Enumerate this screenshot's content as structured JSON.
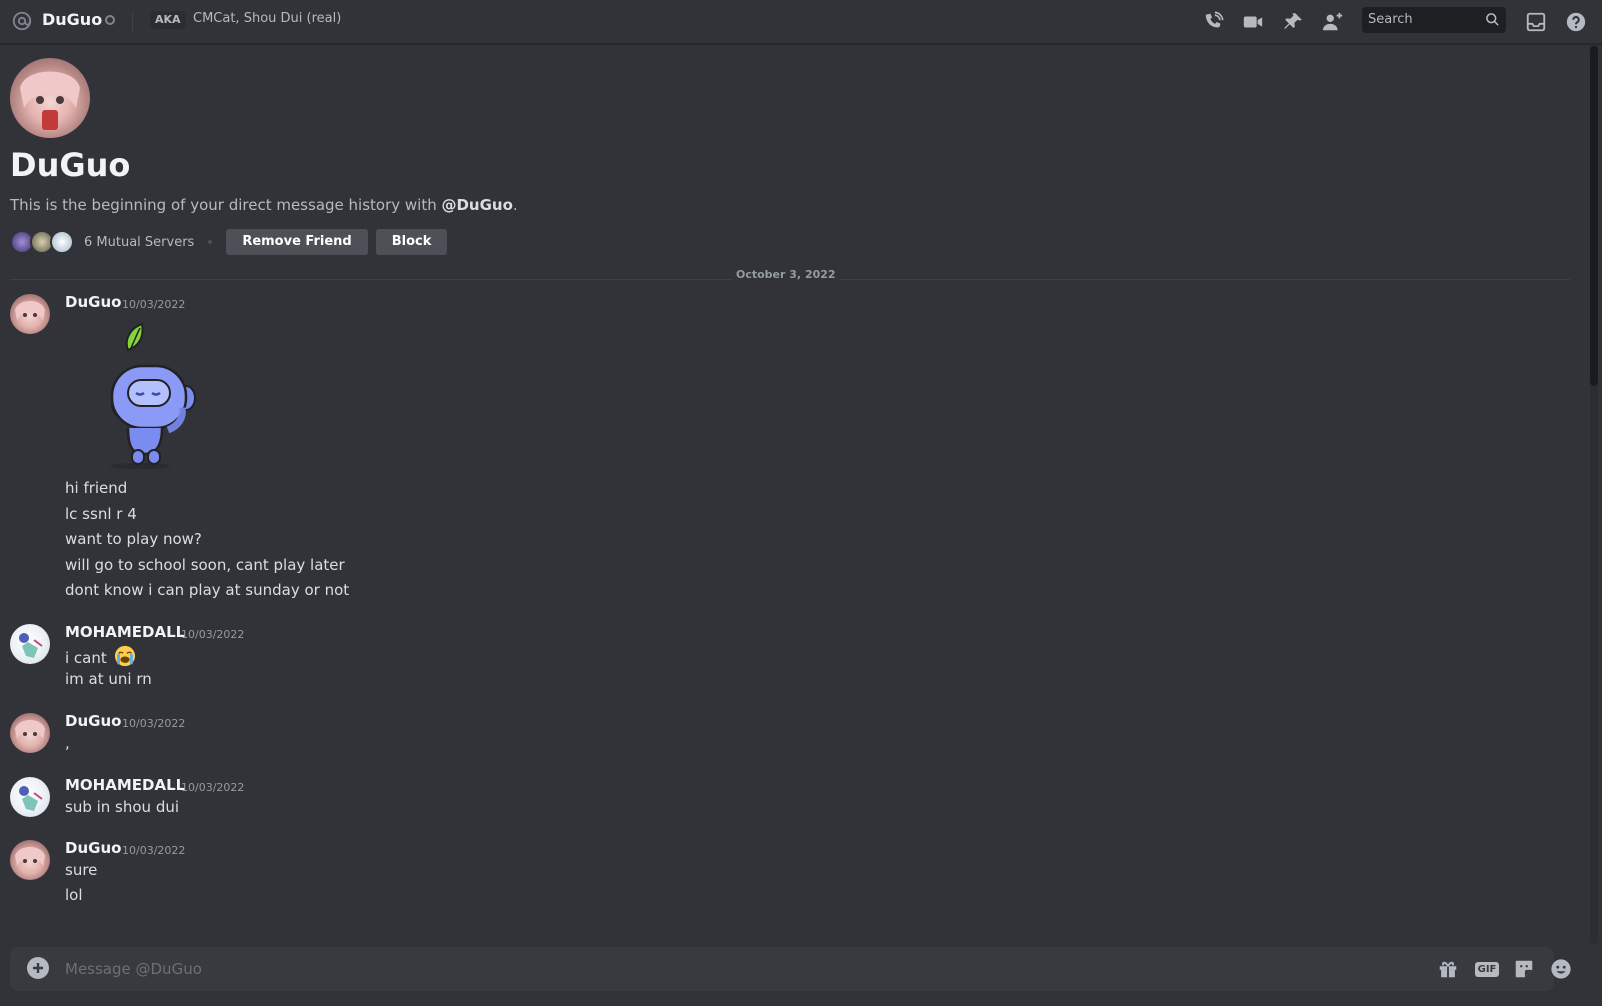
{
  "header": {
    "name": "DuGuo",
    "aka_badge": "AKA",
    "aka_names": "CMCat, Shou Dui (real)",
    "icons": [
      "at-icon",
      "status-offline-icon",
      "voice-call-icon",
      "video-call-icon",
      "pinned-messages-icon",
      "add-friends-to-dm-icon",
      "search-icon",
      "inbox-icon",
      "help-icon"
    ],
    "search_placeholder": "Search"
  },
  "welcome": {
    "title": "DuGuo",
    "subtitle_prefix": "This is the beginning of your direct message history with ",
    "subtitle_handle": "@DuGuo",
    "subtitle_suffix": ".",
    "mutual_servers": "6 Mutual Servers",
    "remove_friend": "Remove Friend",
    "block": "Block"
  },
  "date_divider": "October 3, 2022",
  "messages": [
    {
      "author": "DuGuo",
      "time": "10/03/2022",
      "lines": [
        "hi friend",
        "lc ssnl r 4",
        "want to play now?",
        "will go to school soon, cant play later",
        "dont know i can play at sunday or not"
      ],
      "sticker": "wumpus-leaf-sticker"
    },
    {
      "author": "MOHAMEDALL",
      "time": "10/03/2022",
      "lines": [
        "i cant",
        "im at uni rn"
      ],
      "emoji": "loudly-crying-face"
    },
    {
      "author": "DuGuo",
      "time": "10/03/2022",
      "lines": [
        ","
      ]
    },
    {
      "author": "MOHAMEDALL",
      "time": "10/03/2022",
      "lines": [
        "sub in shou dui"
      ]
    },
    {
      "author": "DuGuo",
      "time": "10/03/2022",
      "lines": [
        "sure",
        "lol"
      ]
    }
  ],
  "composer": {
    "placeholder": "Message @DuGuo",
    "gif_label": "GIF",
    "icons": [
      "attach-plus-icon",
      "gift-icon",
      "gif-icon",
      "sticker-icon",
      "emoji-icon"
    ]
  },
  "colors": {
    "background": "#313338",
    "composer": "#383a40",
    "button": "#4e5058",
    "text_primary": "#f2f3f5",
    "text_muted": "#949ba4"
  }
}
